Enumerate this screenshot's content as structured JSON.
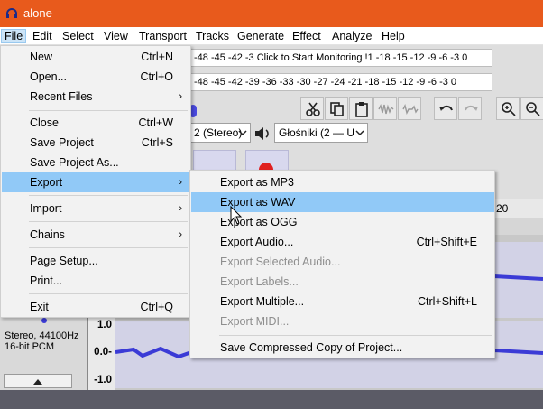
{
  "window": {
    "title": "alone"
  },
  "menubar": [
    "File",
    "Edit",
    "Select",
    "View",
    "Transport",
    "Tracks",
    "Generate",
    "Effect",
    "Analyze",
    "Help"
  ],
  "toolbar": {
    "recording_meter_text": "-48  -45  -42  -3  Click to Start Monitoring  !1  -18  -15  -12   -9   -6   -3   0",
    "playback_meter_text": "-48  -45  -42  -39  -36  -33  -30  -27  -24  -21  -18  -15  -12   -9   -6   -3   0",
    "input_channels": "2 (Stereo)",
    "output_device": "Głośniki (2 — U"
  },
  "ruler": {
    "tick_label": "20"
  },
  "track": {
    "format_line1": "Stereo, 44100Hz",
    "format_line2": "16-bit PCM",
    "scale": {
      "top": "1.0",
      "mid": "0.0-",
      "bottom": "-1.0"
    }
  },
  "file_menu": {
    "items": [
      {
        "label": "New",
        "shortcut": "Ctrl+N"
      },
      {
        "label": "Open...",
        "shortcut": "Ctrl+O"
      },
      {
        "label": "Recent Files",
        "submenu": true
      },
      {
        "label": "Close",
        "shortcut": "Ctrl+W"
      },
      {
        "label": "Save Project",
        "shortcut": "Ctrl+S"
      },
      {
        "label": "Save Project As..."
      },
      {
        "label": "Export",
        "submenu": true
      },
      {
        "label": "Import",
        "submenu": true
      },
      {
        "label": "Chains",
        "submenu": true
      },
      {
        "label": "Page Setup..."
      },
      {
        "label": "Print..."
      },
      {
        "label": "Exit",
        "shortcut": "Ctrl+Q"
      }
    ],
    "arrow_glyph": "›"
  },
  "export_menu": {
    "items": [
      {
        "label": "Export as MP3"
      },
      {
        "label": "Export as WAV"
      },
      {
        "label": "Export as OGG"
      },
      {
        "label": "Export Audio...",
        "shortcut": "Ctrl+Shift+E"
      },
      {
        "label": "Export Selected Audio...",
        "disabled": true
      },
      {
        "label": "Export Labels...",
        "disabled": true
      },
      {
        "label": "Export Multiple...",
        "shortcut": "Ctrl+Shift+L"
      },
      {
        "label": "Export MIDI...",
        "disabled": true
      },
      {
        "label": "Save Compressed Copy of Project..."
      }
    ]
  },
  "colors": {
    "titlebar": "#e85a1c",
    "highlight": "#91c9f7",
    "waveform": "#3b3bd6",
    "record": "#e02020"
  }
}
